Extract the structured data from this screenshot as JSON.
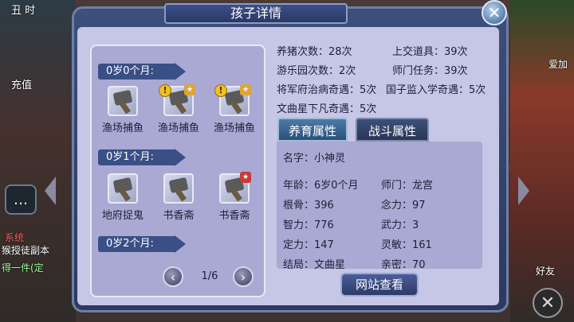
{
  "background": {
    "top_left_label": "丑 时",
    "recharge_label": "充值",
    "chat_icon": "chat-bubble-icon",
    "event_red": "系统",
    "event_text": "猴授徒副本",
    "event_text2": "得一件(定",
    "right_top_label": "爱加",
    "right_friend_label": "好友"
  },
  "dialog": {
    "title": "孩子详情",
    "close_label": "✕"
  },
  "timeline": {
    "groups": [
      {
        "age_label": "0岁0个月:",
        "items": [
          {
            "label": "渔场捕鱼",
            "warn": false,
            "badge": false,
            "badge_red": false
          },
          {
            "label": "渔场捕鱼",
            "warn": true,
            "badge": true,
            "badge_red": false
          },
          {
            "label": "渔场捕鱼",
            "warn": true,
            "badge": true,
            "badge_red": false
          }
        ]
      },
      {
        "age_label": "0岁1个月:",
        "items": [
          {
            "label": "地府捉鬼",
            "warn": false,
            "badge": false,
            "badge_red": false
          },
          {
            "label": "书香斋",
            "warn": false,
            "badge": false,
            "badge_red": false
          },
          {
            "label": "书香斋",
            "warn": false,
            "badge": true,
            "badge_red": true
          }
        ]
      },
      {
        "age_label": "0岁2个月:",
        "items": []
      }
    ],
    "page": "1/6",
    "prev_label": "‹",
    "next_label": "›"
  },
  "stats": {
    "pig_raise": "养猪次数：28次",
    "items_submitted": "上交道具：39次",
    "playground": "游乐园次数：2次",
    "sect_tasks": "师门任务：39次",
    "general_adventure": "将军府治病奇遇：5次",
    "academy_adventure": "国子监入学奇遇：5次",
    "wenqu_adventure": "文曲星下凡奇遇：5次"
  },
  "tabs": {
    "nurture": "养育属性",
    "combat": "战斗属性"
  },
  "info": {
    "name": "名字：小神灵",
    "age": "年龄：6岁0个月",
    "sect": "师门：龙宫",
    "bone": "根骨：396",
    "focus": "念力：97",
    "intellect": "智力：776",
    "force": "武力：3",
    "composure": "定力：147",
    "agility": "灵敏：161",
    "ending": "结局：文曲星",
    "intimacy": "亲密：70"
  },
  "web_button": "网站查看"
}
